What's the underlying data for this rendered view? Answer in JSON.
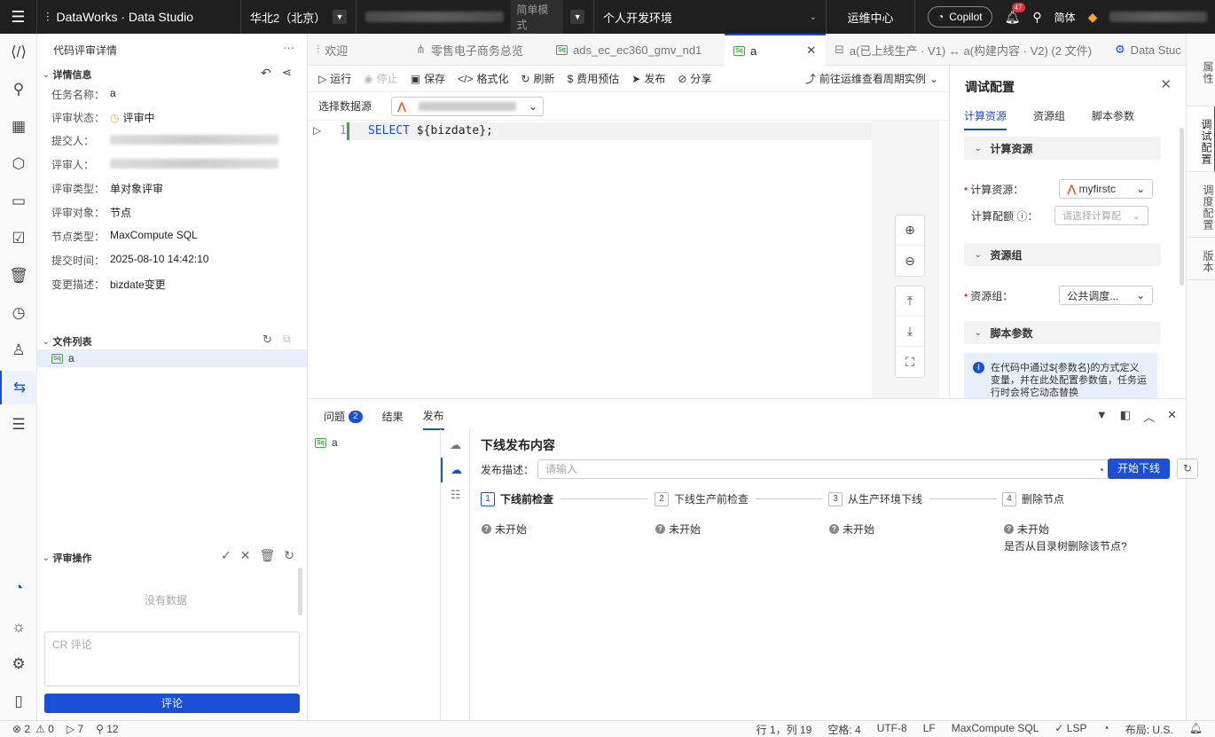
{
  "topbar": {
    "brand": "DataWorks · Data Studio",
    "region": "华北2（北京）",
    "mode": "简单模式",
    "environment": "个人开发环境",
    "ops_center": "运维中心",
    "copilot": "Copilot",
    "notification_count": "47",
    "language": "简体"
  },
  "left_panel": {
    "title": "代码评审详情",
    "details_header": "详情信息",
    "fields": [
      {
        "label": "任务名称：",
        "value": "a"
      },
      {
        "label": "评审状态：",
        "value": "评审中"
      },
      {
        "label": "提交人：",
        "value": ""
      },
      {
        "label": "评审人：",
        "value": ""
      },
      {
        "label": "评审类型：",
        "value": "单对象评审"
      },
      {
        "label": "评审对象：",
        "value": "节点"
      },
      {
        "label": "节点类型：",
        "value": "MaxCompute SQL"
      },
      {
        "label": "提交时间：",
        "value": "2025-08-10 14:42:10"
      },
      {
        "label": "变更描述：",
        "value": "bizdate变更"
      }
    ],
    "file_list_header": "文件列表",
    "file_name": "a",
    "review_ops_header": "评审操作",
    "no_data": "没有数据",
    "cr_placeholder": "CR 评论",
    "comment_button": "评论"
  },
  "tabs": [
    {
      "label": "欢迎"
    },
    {
      "label": "零售电子商务总览"
    },
    {
      "label": "ads_ec_ec360_gmv_nd1"
    },
    {
      "label": "a"
    },
    {
      "label": "a(已上线生产 · V1) ↔ a(构建内容 · V2) (2 文件)"
    },
    {
      "label": "Data Stuc"
    }
  ],
  "toolbar": {
    "run": "运行",
    "stop": "停止",
    "save": "保存",
    "format": "格式化",
    "refresh": "刷新",
    "cost": "费用预估",
    "publish": "发布",
    "share": "分享",
    "goto_ops": "前往运维查看周期实例"
  },
  "datasource": {
    "label": "选择数据源"
  },
  "editor": {
    "line_number": "1",
    "keyword": "SELECT",
    "rest": " ${bizdate};"
  },
  "debug_panel": {
    "title": "调试配置",
    "tabs": [
      "计算资源",
      "资源组",
      "脚本参数"
    ],
    "compute_section": "计算资源",
    "compute_label": "计算资源：",
    "compute_value": "myfirstc",
    "quota_label": "计算配额 ⓘ：",
    "quota_placeholder": "请选择计算配",
    "rg_section": "资源组",
    "rg_label": "资源组：",
    "rg_value": "公共调度...",
    "script_section": "脚本参数",
    "info_text": "在代码中通过${参数名}的方式定义变量，并在此处配置参数值，任务运行时会将它动态替换"
  },
  "right_rail": [
    "属性",
    "调试配置",
    "调度配置",
    "版本"
  ],
  "bottom_panel": {
    "tabs": {
      "issues": "问题",
      "issues_count": "2",
      "results": "结果",
      "publish": "发布"
    },
    "list_item": "a",
    "title": "下线发布内容",
    "desc_label": "发布描述：",
    "desc_placeholder": "请输入",
    "start_button": "开始下线",
    "steps": [
      {
        "num": "1",
        "label": "下线前检查",
        "status": "未开始"
      },
      {
        "num": "2",
        "label": "下线生产前检查",
        "status": "未开始"
      },
      {
        "num": "3",
        "label": "从生产环境下线",
        "status": "未开始"
      },
      {
        "num": "4",
        "label": "删除节点",
        "status": "未开始"
      }
    ],
    "step4_note": "是否从目录树删除该节点?"
  },
  "statusbar": {
    "errors": "⊗ 2",
    "warnings": "⚠ 0",
    "runs": "▷ 7",
    "sends": "⚲ 12",
    "position": "行 1，列 19",
    "spaces": "空格: 4",
    "encoding": "UTF-8",
    "eol": "LF",
    "language": "MaxCompute SQL",
    "lsp": "✓ LSP",
    "layout": "布局: U.S."
  }
}
